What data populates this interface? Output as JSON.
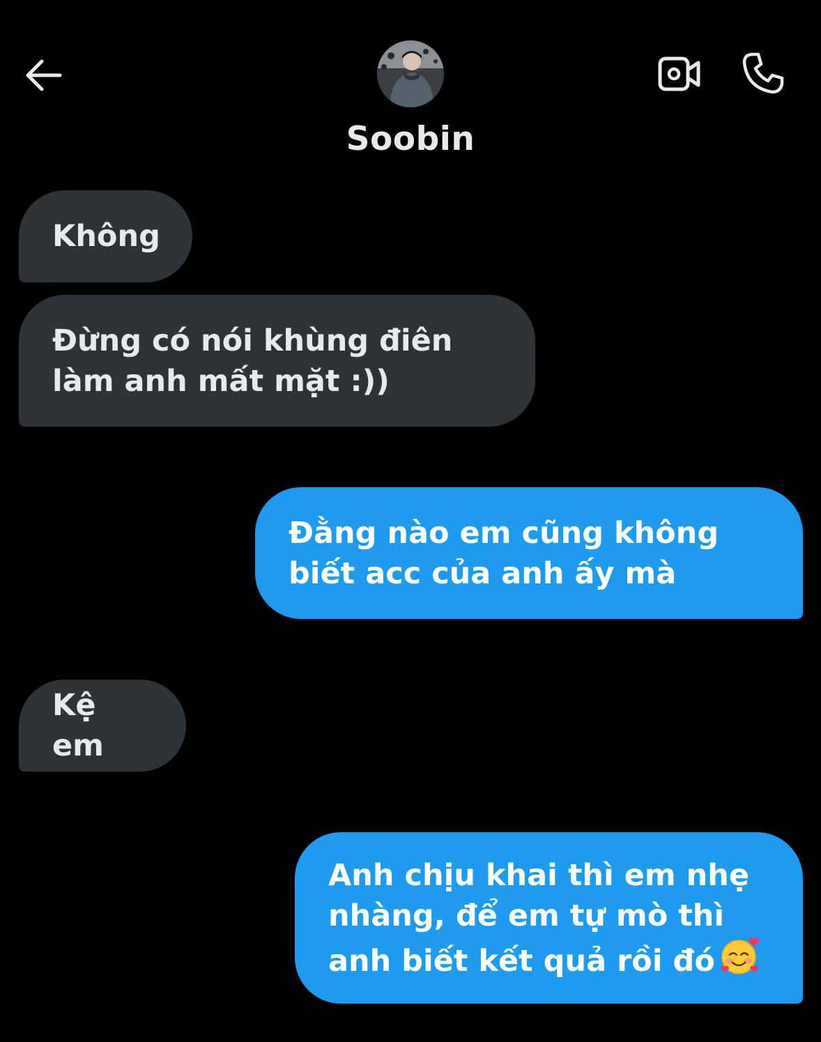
{
  "header": {
    "contact_name": "Soobin",
    "back_icon": "arrow-left-icon",
    "video_icon": "video-camera-icon",
    "call_icon": "phone-icon"
  },
  "messages": [
    {
      "direction": "incoming",
      "text": "Không"
    },
    {
      "direction": "incoming",
      "text": "Đừng có nói khùng điên làm anh mất mặt :))"
    },
    {
      "direction": "outgoing",
      "text": "Đằng nào em cũng không biết acc của anh ấy mà"
    },
    {
      "direction": "incoming",
      "text": "Kệ em"
    },
    {
      "direction": "outgoing",
      "text": "Anh chịu khai thì em nhẹ nhàng, để em tự mò thì anh biết kết quả rồi đó",
      "emoji": "smiling-face-with-hearts-icon"
    }
  ],
  "colors": {
    "background": "#000000",
    "incoming_bubble": "#2f3336",
    "outgoing_bubble": "#1d9bf0",
    "text": "#e7e9ea"
  }
}
